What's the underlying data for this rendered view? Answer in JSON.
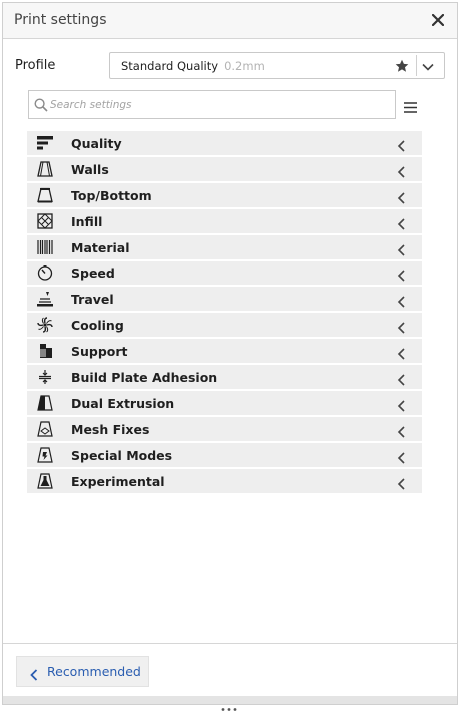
{
  "window": {
    "title": "Print settings",
    "close_icon": "close-icon"
  },
  "profile": {
    "label": "Profile",
    "selected_name": "Standard Quality",
    "selected_layer": "0.2mm",
    "favorite_icon": "star-icon",
    "dropdown_icon": "chevron-down-icon"
  },
  "search": {
    "placeholder": "Search settings",
    "value": ""
  },
  "categories": [
    {
      "label": "Quality",
      "icon": "quality-icon"
    },
    {
      "label": "Walls",
      "icon": "walls-icon"
    },
    {
      "label": "Top/Bottom",
      "icon": "top-bottom-icon"
    },
    {
      "label": "Infill",
      "icon": "infill-icon"
    },
    {
      "label": "Material",
      "icon": "material-icon"
    },
    {
      "label": "Speed",
      "icon": "speed-icon"
    },
    {
      "label": "Travel",
      "icon": "travel-icon"
    },
    {
      "label": "Cooling",
      "icon": "cooling-icon"
    },
    {
      "label": "Support",
      "icon": "support-icon"
    },
    {
      "label": "Build Plate Adhesion",
      "icon": "build-plate-adhesion-icon"
    },
    {
      "label": "Dual Extrusion",
      "icon": "dual-extrusion-icon"
    },
    {
      "label": "Mesh Fixes",
      "icon": "mesh-fixes-icon"
    },
    {
      "label": "Special Modes",
      "icon": "special-modes-icon"
    },
    {
      "label": "Experimental",
      "icon": "experimental-icon"
    }
  ],
  "footer": {
    "recommended_label": "Recommended"
  },
  "colors": {
    "accent": "#2a5db0",
    "row_bg": "#eeeeee",
    "icon": "#1f1f1f"
  }
}
